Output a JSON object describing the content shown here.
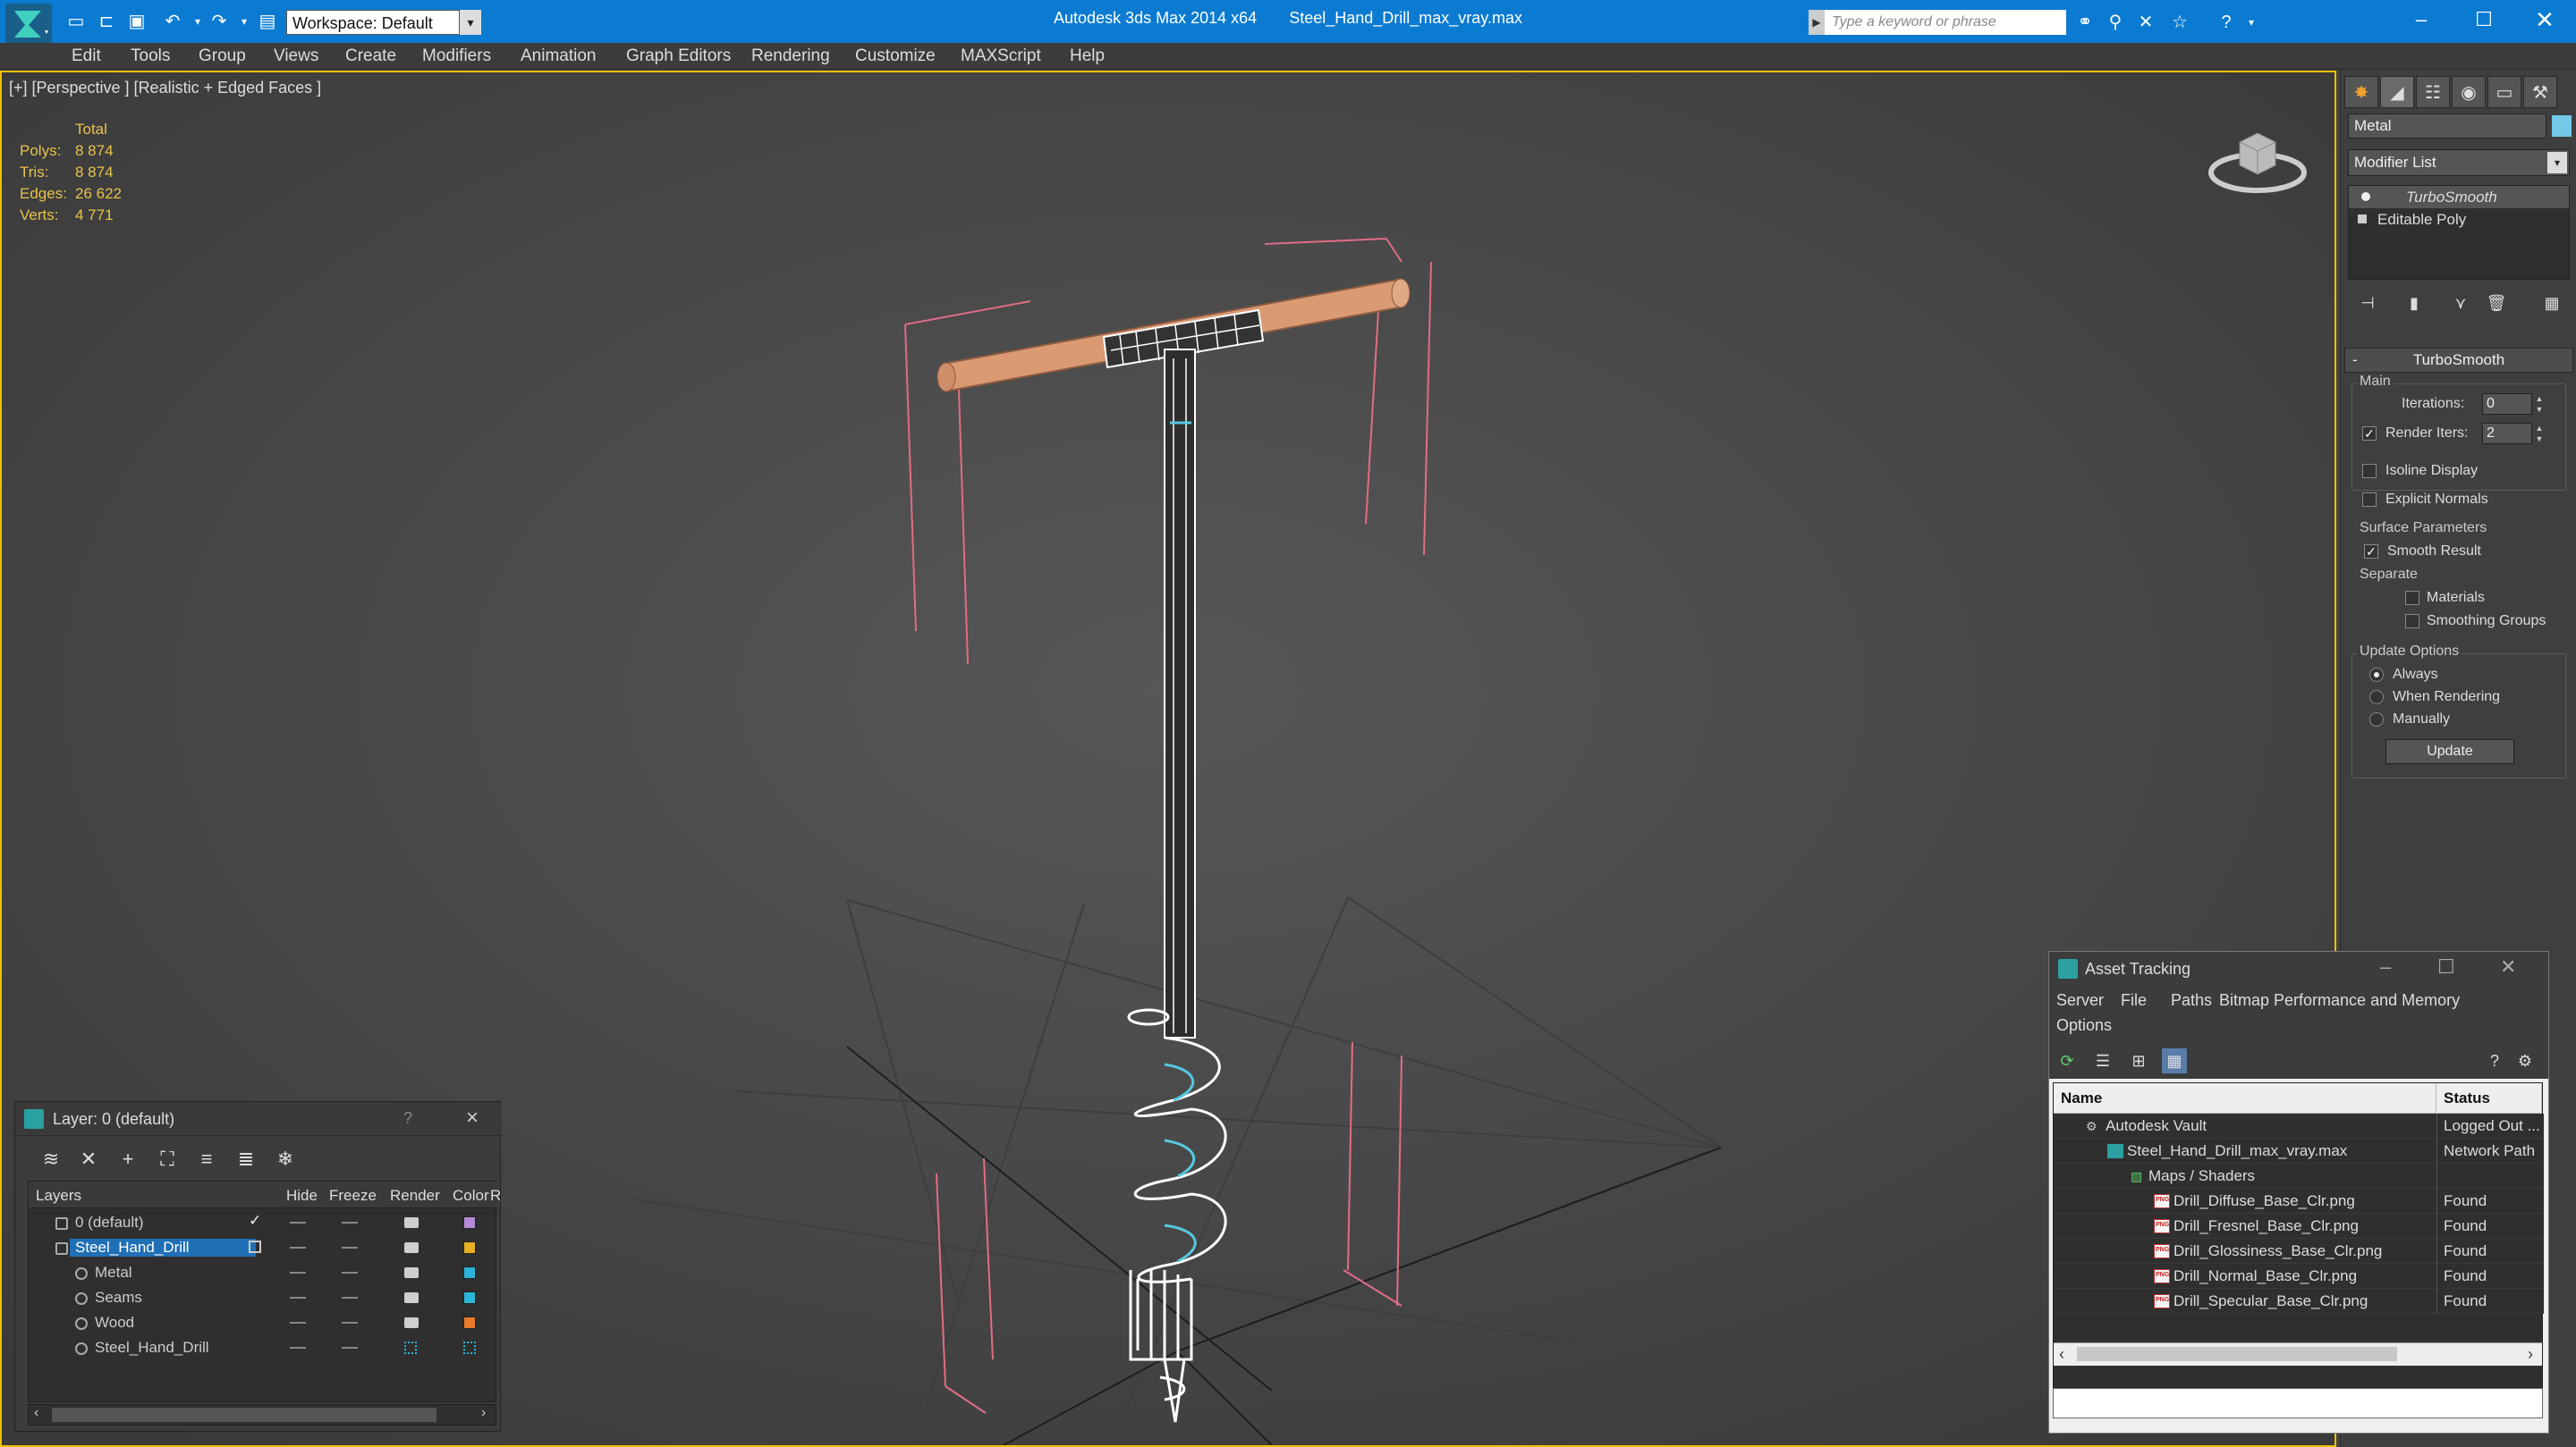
{
  "title_bar": {
    "app_title": "Autodesk 3ds Max  2014 x64",
    "file_name": "Steel_Hand_Drill_max_vray.max",
    "workspace": "Workspace: Default",
    "search_placeholder": "Type a keyword or phrase"
  },
  "menu": {
    "items": [
      "Edit",
      "Tools",
      "Group",
      "Views",
      "Create",
      "Modifiers",
      "Animation",
      "Graph Editors",
      "Rendering",
      "Customize",
      "MAXScript",
      "Help"
    ]
  },
  "viewport": {
    "label": "[+] [Perspective ] [Realistic + Edged Faces ]",
    "stats": {
      "header": "Total",
      "rows": [
        {
          "label": "Polys:",
          "value": "8 874"
        },
        {
          "label": "Tris:",
          "value": "8 874"
        },
        {
          "label": "Edges:",
          "value": "26 622"
        },
        {
          "label": "Verts:",
          "value": "4 771"
        }
      ]
    }
  },
  "command_panel": {
    "object_name": "Metal",
    "object_color": "#73c9e6",
    "modifier_list": "Modifier List",
    "stack": [
      "TurboSmooth",
      "Editable Poly"
    ],
    "rollout_title": "TurboSmooth",
    "main_group": "Main",
    "iterations_label": "Iterations:",
    "iterations_value": "0",
    "render_iters_label": "Render Iters:",
    "render_iters_value": "2",
    "isoline_label": "Isoline Display",
    "explicit_normals_label": "Explicit Normals",
    "surface_group": "Surface Parameters",
    "smooth_result_label": "Smooth Result",
    "separate_label": "Separate",
    "materials_label": "Materials",
    "smoothing_groups_label": "Smoothing Groups",
    "update_group": "Update Options",
    "always_label": "Always",
    "when_rendering_label": "When Rendering",
    "manually_label": "Manually",
    "update_button": "Update"
  },
  "layer_dialog": {
    "title": "Layer: 0 (default)",
    "help": "?",
    "columns": [
      "Layers",
      "Hide",
      "Freeze",
      "Render",
      "Color",
      "R"
    ],
    "rows": [
      {
        "name": "0 (default)",
        "color": "#b58ad6"
      },
      {
        "name": "Steel_Hand_Drill",
        "color": "#e8b020"
      },
      {
        "name": "Metal",
        "color": "#2bb5d9"
      },
      {
        "name": "Seams",
        "color": "#2bb5d9"
      },
      {
        "name": "Wood",
        "color": "#e87a2a"
      },
      {
        "name": "Steel_Hand_Drill",
        "color": "#2bb5d9"
      }
    ]
  },
  "asset_dialog": {
    "title": "Asset Tracking",
    "menus": [
      "Server",
      "File",
      "Paths",
      "Bitmap Performance and Memory",
      "Options"
    ],
    "columns": [
      "Name",
      "Status"
    ],
    "rows": [
      {
        "name": "Autodesk Vault",
        "status": "Logged Out ..."
      },
      {
        "name": "Steel_Hand_Drill_max_vray.max",
        "status": "Network Path"
      },
      {
        "name": "Maps / Shaders",
        "status": ""
      },
      {
        "name": "Drill_Diffuse_Base_Clr.png",
        "status": "Found"
      },
      {
        "name": "Drill_Fresnel_Base_Clr.png",
        "status": "Found"
      },
      {
        "name": "Drill_Glossiness_Base_Clr.png",
        "status": "Found"
      },
      {
        "name": "Drill_Normal_Base_Clr.png",
        "status": "Found"
      },
      {
        "name": "Drill_Specular_Base_Clr.png",
        "status": "Found"
      }
    ]
  }
}
